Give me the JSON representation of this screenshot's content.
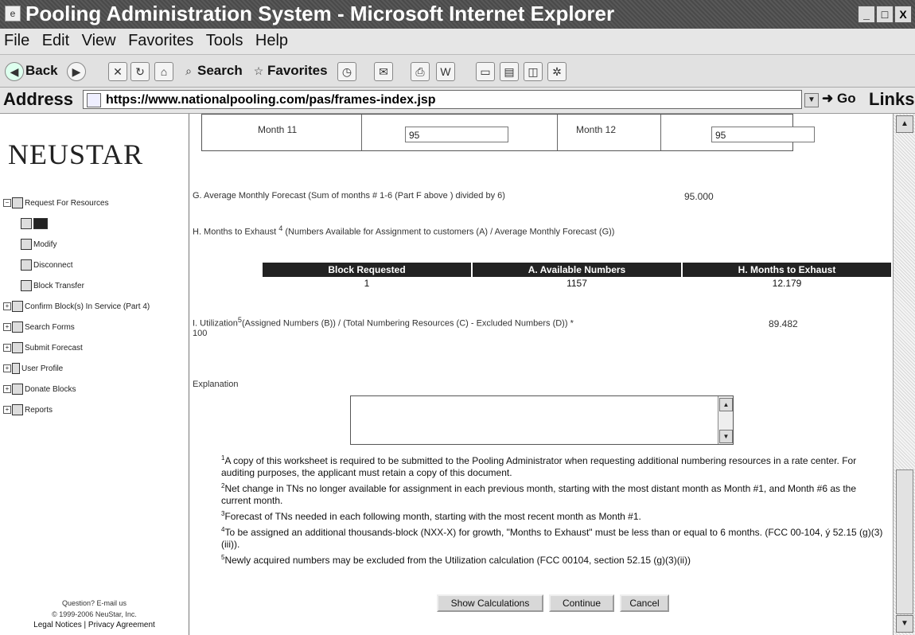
{
  "window": {
    "title": "Pooling Administration System - Microsoft Internet Explorer",
    "minimize": "_",
    "maximize": "□",
    "close": "X"
  },
  "menu": [
    "File",
    "Edit",
    "View",
    "Favorites",
    "Tools",
    "Help"
  ],
  "toolbar": {
    "back": "Back",
    "search": "Search",
    "favorites": "Favorites"
  },
  "address": {
    "label": "Address",
    "url": "https://www.nationalpooling.com/pas/frames-index.jsp",
    "go": "Go",
    "links": "Links"
  },
  "sidebar": {
    "logo": "NEUSTAR",
    "tree": [
      {
        "label": "Request For Resources",
        "expander": "−",
        "level": 0
      },
      {
        "label": "",
        "level": 1,
        "selected": true
      },
      {
        "label": "Modify",
        "level": 1
      },
      {
        "label": "Disconnect",
        "level": 1
      },
      {
        "label": "Block Transfer",
        "level": 1
      },
      {
        "label": "Confirm Block(s) In Service (Part 4)",
        "expander": "+",
        "level": 0
      },
      {
        "label": "Search Forms",
        "expander": "+",
        "level": 0
      },
      {
        "label": "Submit Forecast",
        "expander": "+",
        "level": 0
      },
      {
        "label": "User Profile",
        "expander": "+",
        "level": 0
      },
      {
        "label": "Donate Blocks",
        "expander": "+",
        "level": 0
      },
      {
        "label": "Reports",
        "expander": "+",
        "level": 0
      }
    ],
    "footer": {
      "question": "Question? E-mail us",
      "copyright": "© 1999-2006 NeuStar, Inc.",
      "legal": "Legal Notices | Privacy Agreement"
    }
  },
  "months": {
    "month11_label": "Month 11",
    "month11_value": "95",
    "month12_label": "Month 12",
    "month12_value": "95"
  },
  "sectionG": {
    "label": "G. Average Monthly Forecast (Sum of months # 1-6 (Part F above ) divided by 6)",
    "value": "95.000"
  },
  "sectionH": {
    "label_pre": "H. Months to Exhaust ",
    "label_sup": "4",
    "label_post": " (Numbers Available for Assignment to customers (A) / Average Monthly Forecast (G))"
  },
  "exhaust_table": {
    "headers": [
      "Block Requested",
      "A. Available Numbers",
      "H. Months to Exhaust"
    ],
    "values": [
      "1",
      "1157",
      "12.179"
    ]
  },
  "sectionI": {
    "label_pre": "I. Utilization",
    "label_sup": "5",
    "label_post": "(Assigned Numbers (B)) / (Total Numbering Resources (C) - Excluded Numbers (D)) *",
    "label_line2": "100",
    "value": "89.482"
  },
  "explanation": {
    "label": "Explanation",
    "value": ""
  },
  "notes": [
    {
      "sup": "1",
      "text": "A copy of this worksheet is required to be submitted to the Pooling Administrator when requesting additional numbering resources in a rate center. For auditing purposes, the applicant must retain a copy of this document."
    },
    {
      "sup": "2",
      "text": "Net change in TNs no longer available for assignment in each previous month, starting with the most distant month as Month #1, and Month #6 as the current month."
    },
    {
      "sup": "3",
      "text": "Forecast of TNs needed in each following month, starting with the most recent month as Month #1."
    },
    {
      "sup": "4",
      "text": "To be assigned an additional thousands-block (NXX-X) for growth, \"Months to Exhaust\" must be less than or equal to 6 months. (FCC 00-104, ý 52.15 (g)(3)(iii))."
    },
    {
      "sup": "5",
      "text": "Newly acquired numbers may be excluded from the Utilization calculation (FCC 00104, section 52.15 (g)(3)(ii))"
    }
  ],
  "buttons": {
    "show_calculations": "Show Calculations",
    "continue": "Continue",
    "cancel": "Cancel"
  }
}
